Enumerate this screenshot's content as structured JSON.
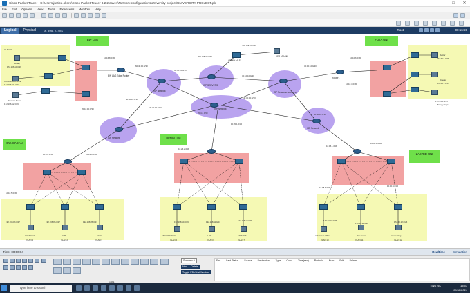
{
  "window": {
    "title": "Cisco Packet Tracer - C:\\Users\\justice.okoro\\Cisco Packet Tracer 8.2.2\\saves\\Network configurations\\University project\\UNIVERSITY PROJECT.pkt"
  },
  "menu": [
    "File",
    "Edit",
    "Options",
    "View",
    "Tools",
    "Extensions",
    "Window",
    "Help"
  ],
  "modebar": {
    "logical": "Logical",
    "physical": "Physical",
    "coords": "x: 895, y: 481",
    "root": "Root",
    "clock": "00:16:59"
  },
  "zones": {
    "labels": {
      "bw_lag": "BW LAG",
      "fota_uni": "FOTA UNI",
      "bw_badan": "BW. BADAN",
      "benin_uni": "BENIN UNI",
      "lasted_uni": "LASTED UNI"
    }
  },
  "clouds": {
    "isp1": "ISP Network",
    "isp2": "ISP Network",
    "isp_servers": "ISP SERVERS",
    "isp3": "ISP Network",
    "isp4": "ISP Network",
    "isp5": "ISP Network"
  },
  "devices": {
    "isp_admin": "ISP ADMIN",
    "admin_mls": "ADMIN MLS",
    "router1": "Router1",
    "bw_edge": "BW LAG Edge Router",
    "isp_admin_net": "209.165.64.0/30",
    "lag_pcs": [
      {
        "name": "Library",
        "ip": "172.166.10.0/26",
        "vlan": "VLAN 10"
      },
      {
        "name": "Conference Centre",
        "ip": "172.166.11.0/26",
        "vlan": "VLAN 11"
      },
      {
        "name": "Student Room",
        "ip": "172.166.12.0/26",
        "vlan": "VLAN 12"
      }
    ],
    "fota_pcs": [
      {
        "name": "Rector",
        "ip": "172.64.6.0/25"
      },
      {
        "name": "Director",
        "ip": "172.64.7.0/25"
      },
      {
        "name": "Biology Dept",
        "ip": "172.64.8.0/25"
      }
    ],
    "badan_pcs": [
      {
        "name": "COMP SCI",
        "ip": "192.168.84.0/27",
        "vlan": "VLAN 4"
      },
      {
        "name": "CBT",
        "ip": "192.168.85.0/27",
        "vlan": "VLAN 2"
      },
      {
        "name": "SGIC",
        "ip": "192.168.86.0/27",
        "vlan": "VLAN 3"
      }
    ],
    "benin_pcs": [
      {
        "name": "ENGINEERING",
        "ip": "192.168.10.0/26",
        "vlan": "VLAN 5"
      },
      {
        "name": "LAW",
        "ip": "192.168.11.0/27",
        "vlan": "VLAN 6"
      },
      {
        "name": "FINANCE",
        "ip": "192.168.12.0/25",
        "vlan": "VLAN 7"
      }
    ],
    "lasted_pcs": [
      {
        "name": "Admission Office",
        "ip": "172.60.10.0/26",
        "vlan": "VLAN 10"
      },
      {
        "name": "Bias Cont",
        "ip": "172.60.11.0/26",
        "vlan": "VLAN 11"
      },
      {
        "name": "Accounting",
        "ip": "172.60.12.0/26",
        "vlan": "VLAN 12"
      }
    ]
  },
  "links": {
    "l1": "30.30.10.0/30",
    "l2": "60.40.10.0/30",
    "l3": "209.165.32.0/30",
    "l4": "30.10.10.0/30",
    "l5": "30.10.10.0/30",
    "l6": "10.10.6.0/30",
    "l7": "40.30.10.0/30",
    "l8": "20.4.4.0/30",
    "l9": "40.30.10.0/30",
    "l10": "50.40.10.0/30",
    "l11": "20.10.10.0/30",
    "l12": "10.10.4.0/30",
    "l13": "10.20.1.0/30",
    "l14": "10.10.5.0/30",
    "l15": "10.16.8.0/30",
    "l16": "10.30.1.0/30",
    "l17": "10.10.4.0/30",
    "l18": "10.12.3.0/30",
    "l19": "10.15.1.0/30",
    "l20": "10.26.2.0/30",
    "l21": "10.18.6.0/30",
    "l22": "10.6.6.0/30"
  },
  "bottom": {
    "time": "Time: 00:00:04",
    "realtime": "Realtime",
    "simulation": "Simulation",
    "scenario": "Scenario 0",
    "new": "New",
    "delete": "Delete",
    "toggle": "Toggle PDU List Window",
    "devcaption": "1841",
    "pdu_headers": [
      "Fire",
      "Last Status",
      "Source",
      "Destination",
      "Type",
      "Color",
      "Time(sec)",
      "Periodic",
      "Num",
      "Edit",
      "Delete"
    ]
  },
  "taskbar": {
    "search": "Type here to search",
    "lang": "ENG UK",
    "time": "15:57",
    "date": "09/11/2024"
  }
}
